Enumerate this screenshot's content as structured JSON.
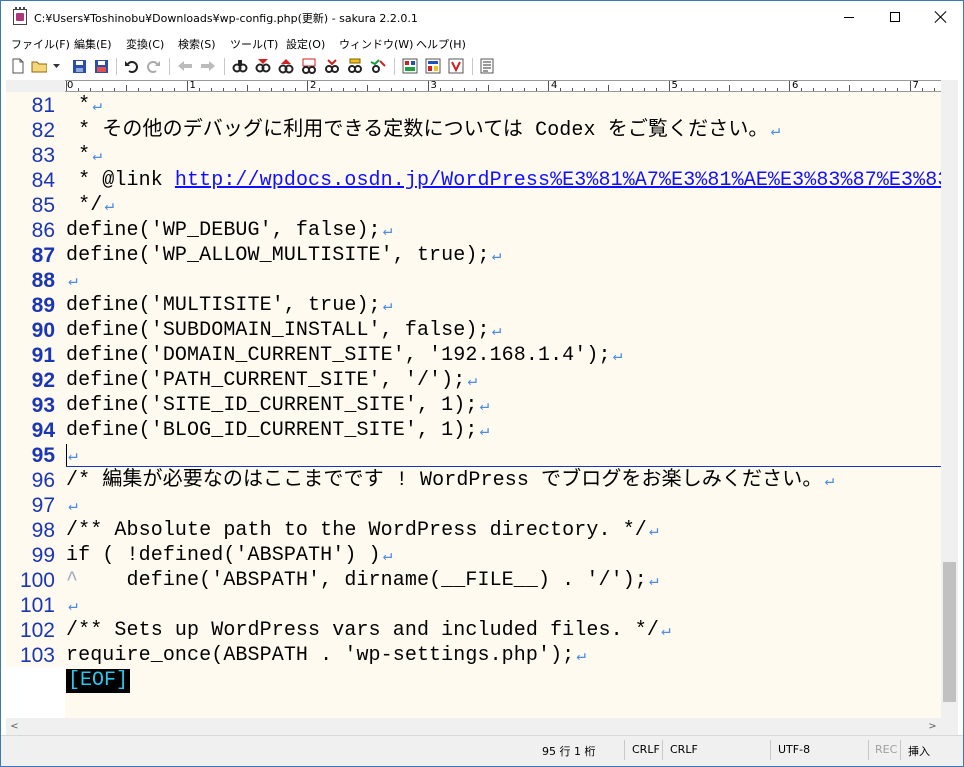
{
  "window": {
    "title": "C:¥Users¥Toshinobu¥Downloads¥wp-config.php(更新) - sakura 2.2.0.1",
    "minimize": "minimize",
    "maximize": "maximize",
    "close": "close"
  },
  "menu": [
    "ファイル(F)",
    "編集(E)",
    "変換(C)",
    "検索(S)",
    "ツール(T)",
    "設定(O)",
    "ウィンドウ(W)",
    "ヘルプ(H)"
  ],
  "toolbar": {
    "icons": [
      "new-file-icon",
      "open-folder-icon",
      "dropdown-icon",
      "save-icon",
      "save-all-icon",
      "undo-icon",
      "redo-icon",
      "back-icon",
      "forward-icon",
      "search-icon",
      "search-next-icon",
      "search-prev-icon",
      "grep-icon",
      "replace-icon",
      "bookmark-icon",
      "compare-icon",
      "outline-icon",
      "tag-jump-icon",
      "settings-icon"
    ]
  },
  "ruler": {
    "numbers": [
      "0",
      "1",
      "2",
      "3",
      "4",
      "5",
      "6",
      "7"
    ]
  },
  "editor": {
    "lines": [
      {
        "num": "81",
        "text": " *",
        "bold": false
      },
      {
        "num": "82",
        "text": " * その他のデバッグに利用できる定数については Codex をご覧ください。",
        "bold": false
      },
      {
        "num": "83",
        "text": " *",
        "bold": false
      },
      {
        "num": "84",
        "text": " * @link ",
        "link": "http://wpdocs.osdn.jp/WordPress%E3%81%A7%E3%81%AE%E3%83%87%E3%83",
        "bold": false
      },
      {
        "num": "85",
        "text": " */",
        "bold": false
      },
      {
        "num": "86",
        "text": "define('WP_DEBUG', false);",
        "bold": false
      },
      {
        "num": "87",
        "text": "define('WP_ALLOW_MULTISITE', true);",
        "bold": true
      },
      {
        "num": "88",
        "text": "",
        "bold": true
      },
      {
        "num": "89",
        "text": "define('MULTISITE', true);",
        "bold": true
      },
      {
        "num": "90",
        "text": "define('SUBDOMAIN_INSTALL', false);",
        "bold": true
      },
      {
        "num": "91",
        "text": "define('DOMAIN_CURRENT_SITE', '192.168.1.4');",
        "bold": true
      },
      {
        "num": "92",
        "text": "define('PATH_CURRENT_SITE', '/');",
        "bold": true
      },
      {
        "num": "93",
        "text": "define('SITE_ID_CURRENT_SITE', 1);",
        "bold": true
      },
      {
        "num": "94",
        "text": "define('BLOG_ID_CURRENT_SITE', 1);",
        "bold": true
      },
      {
        "num": "95",
        "text": "",
        "bold": true
      },
      {
        "num": "96",
        "text": "/* 編集が必要なのはここまでです ! WordPress でブログをお楽しみください。",
        "bold": false
      },
      {
        "num": "97",
        "text": "",
        "bold": false
      },
      {
        "num": "98",
        "text": "/** Absolute path to the WordPress directory. */",
        "bold": false
      },
      {
        "num": "99",
        "text": "if ( !defined('ABSPATH') )",
        "bold": false
      },
      {
        "num": "100",
        "text": "    define('ABSPATH', dirname(__FILE__) . '/');",
        "tab": "^",
        "bold": false
      },
      {
        "num": "101",
        "text": "",
        "bold": false
      },
      {
        "num": "102",
        "text": "/** Sets up WordPress vars and included files. */",
        "bold": false
      },
      {
        "num": "103",
        "text": "require_once(ABSPATH . 'wp-settings.php');",
        "bold": false
      }
    ],
    "crlf_glyph": "↵",
    "eof": "[EOF]"
  },
  "scrollbar": {
    "left_arrow": "<",
    "right_arrow": ">"
  },
  "status": {
    "position": "95 行  1 桁",
    "line_ending": "CRLF",
    "line_ending2": "CRLF",
    "encoding": "UTF-8",
    "rec": "REC",
    "mode": "挿入"
  },
  "colors": {
    "editor_bg": "#fefaf0",
    "line_number": "#1a36b4",
    "link": "#1010ff",
    "crlf": "#4d8de0",
    "eof_fg": "#26c8f0"
  }
}
